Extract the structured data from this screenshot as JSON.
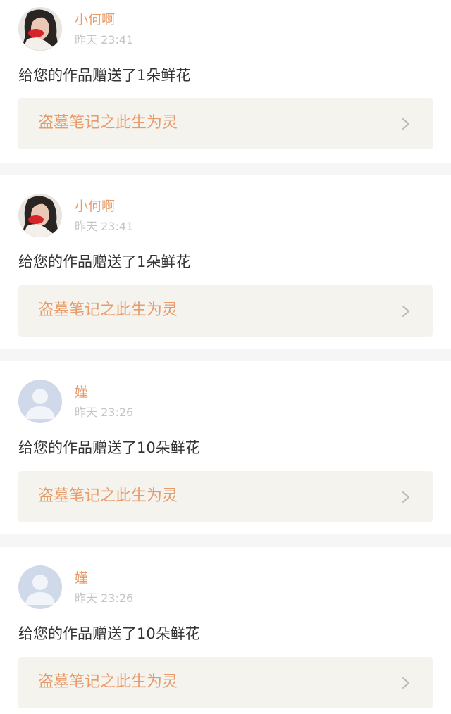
{
  "colors": {
    "accent": "#e89b6a",
    "muted_text": "#c4c4c4",
    "body_text": "#333333",
    "link_background": "#f4f3ee",
    "divider": "#f6f6f6"
  },
  "notifications": [
    {
      "username": "小何啊",
      "time": "昨天 23:41",
      "message": "给您的作品赠送了1朵鲜花",
      "work_title": "盗墓笔记之此生为灵",
      "avatar_type": "photo-avatar",
      "link_icon": "chevron-right-icon"
    },
    {
      "username": "小何啊",
      "time": "昨天 23:41",
      "message": "给您的作品赠送了1朵鲜花",
      "work_title": "盗墓笔记之此生为灵",
      "avatar_type": "photo-avatar",
      "link_icon": "chevron-right-icon"
    },
    {
      "username": "嫤",
      "time": "昨天 23:26",
      "message": "给您的作品赠送了10朵鲜花",
      "work_title": "盗墓笔记之此生为灵",
      "avatar_type": "default-avatar",
      "link_icon": "chevron-right-icon"
    },
    {
      "username": "嫤",
      "time": "昨天 23:26",
      "message": "给您的作品赠送了10朵鲜花",
      "work_title": "盗墓笔记之此生为灵",
      "avatar_type": "default-avatar",
      "link_icon": "chevron-right-icon"
    }
  ]
}
